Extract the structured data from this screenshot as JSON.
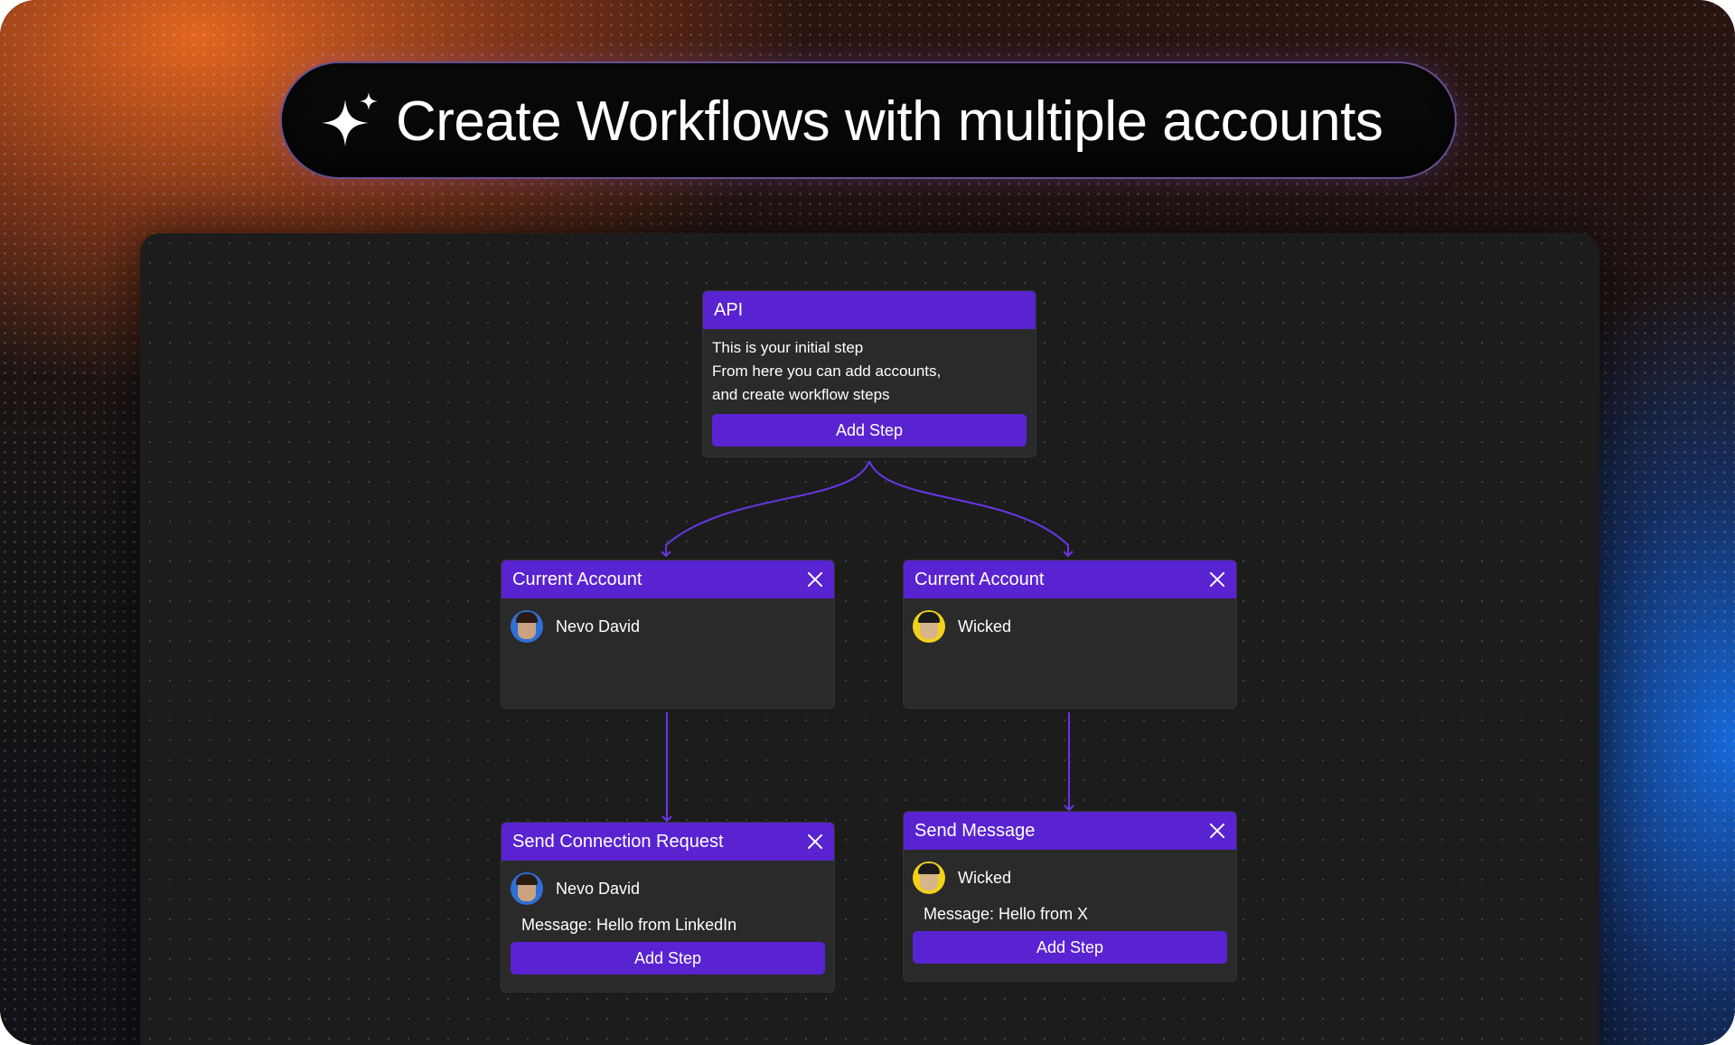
{
  "headline": {
    "text": "Create Workflows with multiple accounts",
    "icon": "sparkle-icon"
  },
  "colors": {
    "accent": "#5a23d1",
    "node_bg": "#2a2a2a",
    "canvas_bg": "#1c1c1c",
    "edge": "#6a35e6"
  },
  "nodes": {
    "api": {
      "title": "API",
      "description": [
        "This is your initial step",
        "From here you can add accounts,",
        "and create workflow steps"
      ],
      "button": "Add Step"
    },
    "account_left": {
      "title": "Current Account",
      "account": "Nevo David"
    },
    "account_right": {
      "title": "Current Account",
      "account": "Wicked"
    },
    "step_left": {
      "title": "Send Connection Request",
      "account": "Nevo David",
      "message": "Message: Hello from LinkedIn",
      "button": "Add Step"
    },
    "step_right": {
      "title": "Send Message",
      "account": "Wicked",
      "message": "Message: Hello from X",
      "button": "Add Step"
    }
  }
}
